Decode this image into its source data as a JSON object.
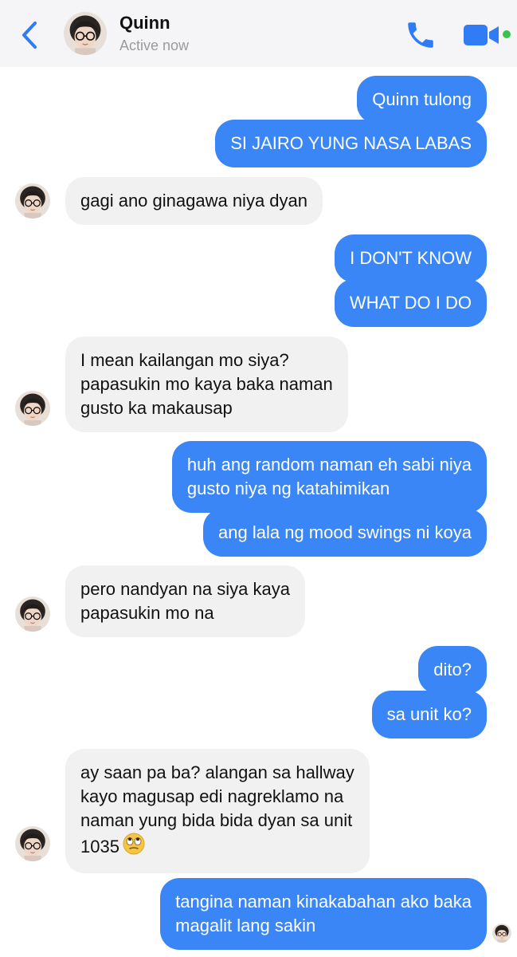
{
  "header": {
    "name": "Quinn",
    "status": "Active now"
  },
  "icons": {
    "back": "chevron-left-icon",
    "call": "phone-icon",
    "video": "video-camera-icon",
    "online": "online-dot-icon"
  },
  "colors": {
    "accent": "#3a86f6",
    "outgoing_bubble": "#3a86f6",
    "incoming_bubble": "#f1f1f2",
    "online": "#3ac24a",
    "status_text": "#9a9a9f"
  },
  "messages": [
    {
      "sender": "me",
      "text": "Quinn tulong"
    },
    {
      "sender": "me",
      "text": "SI JAIRO YUNG NASA LABAS"
    },
    {
      "sender": "Quinn",
      "text": "gagi ano ginagawa niya dyan"
    },
    {
      "sender": "me",
      "text": "I DON'T KNOW"
    },
    {
      "sender": "me",
      "text": "WHAT DO I DO"
    },
    {
      "sender": "Quinn",
      "lines": [
        "I mean kailangan mo siya?",
        "papasukin mo kaya baka naman",
        "gusto ka makausap"
      ]
    },
    {
      "sender": "me",
      "lines": [
        "huh ang random naman eh sabi niya",
        "gusto niya ng katahimikan"
      ]
    },
    {
      "sender": "me",
      "text": "ang lala ng mood swings ni koya"
    },
    {
      "sender": "Quinn",
      "lines": [
        "pero nandyan na siya kaya",
        "papasukin mo na"
      ]
    },
    {
      "sender": "me",
      "text": "dito?"
    },
    {
      "sender": "me",
      "text": "sa unit ko?"
    },
    {
      "sender": "Quinn",
      "lines": [
        "ay saan pa ba? alangan sa hallway",
        "kayo magusap edi nagreklamo na",
        "naman yung bida bida dyan sa unit",
        "1035"
      ],
      "emoji": "eye-roll-emoji"
    },
    {
      "sender": "me",
      "lines": [
        "tangina naman kinakabahan ako baka",
        "magalit lang sakin"
      ]
    }
  ]
}
